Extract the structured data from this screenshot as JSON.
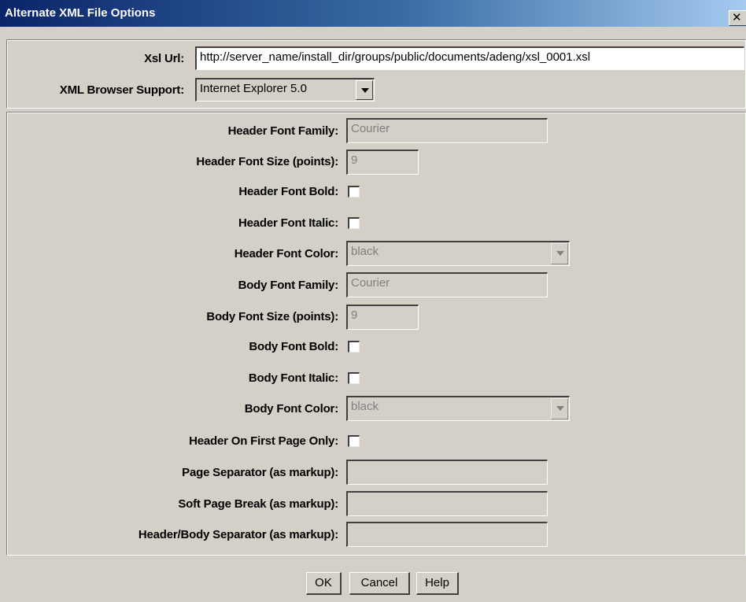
{
  "window": {
    "title": "Alternate XML File Options",
    "close_glyph": "✕"
  },
  "top": {
    "xsl_url_label": "Xsl Url:",
    "xsl_url_value": "http://server_name/install_dir/groups/public/documents/adeng/xsl_0001.xsl",
    "browser_label": "XML Browser Support:",
    "browser_value": "Internet Explorer 5.0"
  },
  "form": {
    "header_font_family_label": "Header Font Family:",
    "header_font_family_value": "Courier",
    "header_font_size_label": "Header Font Size (points):",
    "header_font_size_value": "9",
    "header_font_bold_label": "Header Font Bold:",
    "header_font_bold_checked": false,
    "header_font_italic_label": "Header Font Italic:",
    "header_font_italic_checked": false,
    "header_font_color_label": "Header Font Color:",
    "header_font_color_value": "black",
    "body_font_family_label": "Body Font Family:",
    "body_font_family_value": "Courier",
    "body_font_size_label": "Body Font Size (points):",
    "body_font_size_value": "9",
    "body_font_bold_label": "Body Font Bold:",
    "body_font_bold_checked": false,
    "body_font_italic_label": "Body Font Italic:",
    "body_font_italic_checked": false,
    "body_font_color_label": "Body Font Color:",
    "body_font_color_value": "black",
    "header_first_page_label": "Header On First Page Only:",
    "header_first_page_checked": false,
    "page_separator_label": "Page Separator (as markup):",
    "page_separator_value": "",
    "soft_page_break_label": "Soft Page Break (as markup):",
    "soft_page_break_value": "",
    "header_body_separator_label": "Header/Body Separator (as markup):",
    "header_body_separator_value": ""
  },
  "buttons": {
    "ok": "OK",
    "cancel": "Cancel",
    "help": "Help"
  },
  "colors": {
    "dialog_bg": "#d4d0c8",
    "titlebar": "#0a246a"
  }
}
